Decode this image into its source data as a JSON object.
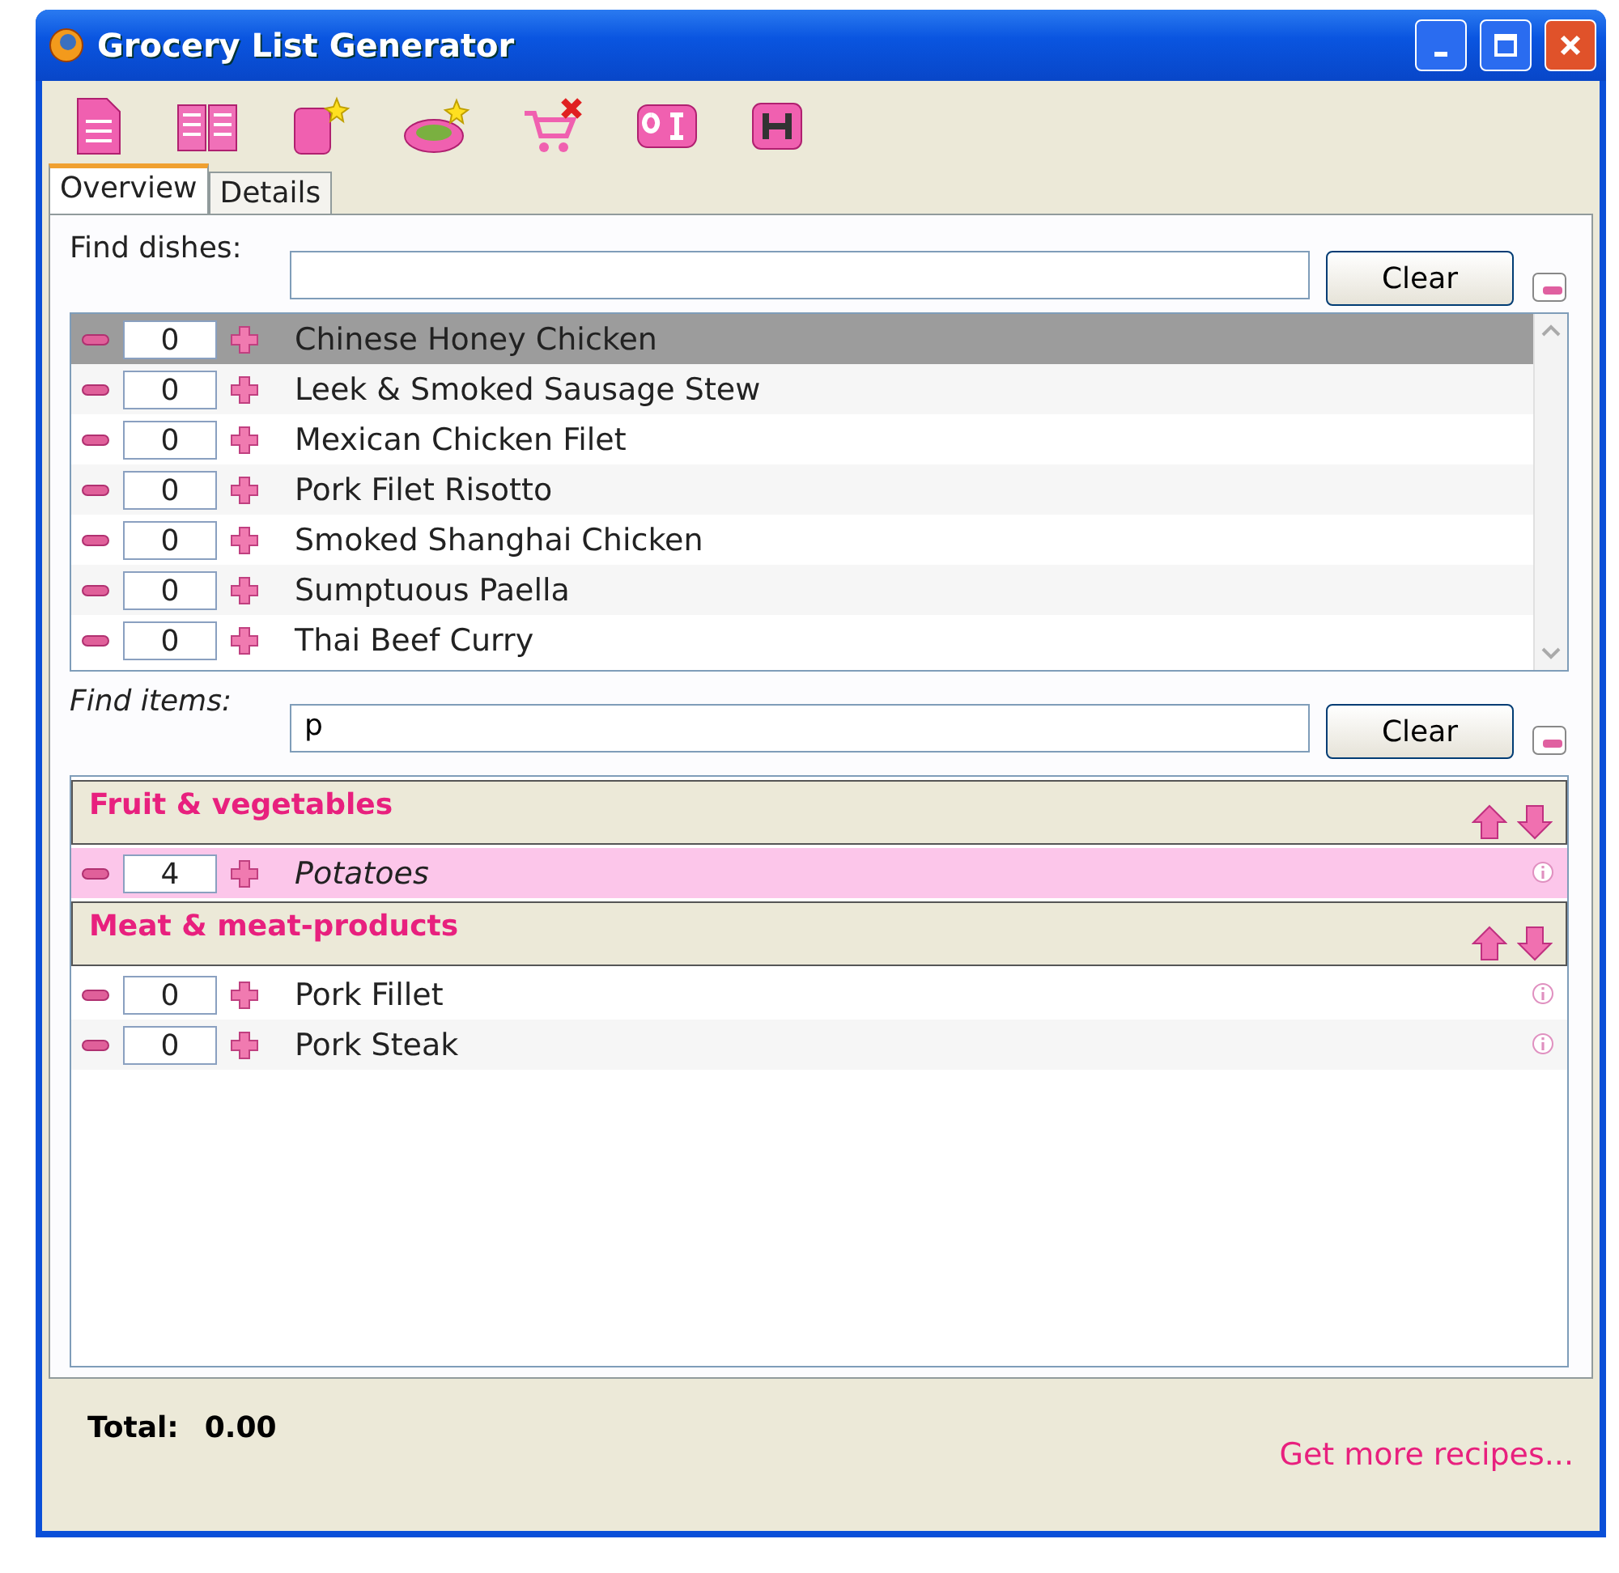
{
  "window": {
    "title": "Grocery List Generator"
  },
  "tabs": [
    {
      "label": "Overview",
      "selected": true
    },
    {
      "label": "Details",
      "selected": false
    }
  ],
  "dish_search": {
    "label": "Find dishes:",
    "button": "Clear"
  },
  "dishes": [
    {
      "qty": "0",
      "name": "Chinese Honey Chicken",
      "selected": true
    },
    {
      "qty": "0",
      "name": "Leek & Smoked Sausage Stew",
      "selected": false
    },
    {
      "qty": "0",
      "name": "Mexican Chicken Filet",
      "selected": false
    },
    {
      "qty": "0",
      "name": "Pork Filet Risotto",
      "selected": false
    },
    {
      "qty": "0",
      "name": "Smoked Shanghai Chicken",
      "selected": false
    },
    {
      "qty": "0",
      "name": "Sumptuous Paella",
      "selected": false
    },
    {
      "qty": "0",
      "name": "Thai Beef Curry",
      "selected": false
    }
  ],
  "item_search": {
    "label": "Find items:",
    "value": "p",
    "button": "Clear"
  },
  "categories": [
    {
      "name": "Fruit & vegetables",
      "items": [
        {
          "qty": "4",
          "name": "Potatoes",
          "selected": true
        }
      ]
    },
    {
      "name": "Meat & meat-products",
      "items": [
        {
          "qty": "0",
          "name": "Pork Fillet",
          "selected": false
        },
        {
          "qty": "0",
          "name": "Pork Steak",
          "selected": false
        }
      ]
    }
  ],
  "footer": {
    "total_label": "Total:",
    "total": "0.00",
    "link": "Get more recipes..."
  }
}
